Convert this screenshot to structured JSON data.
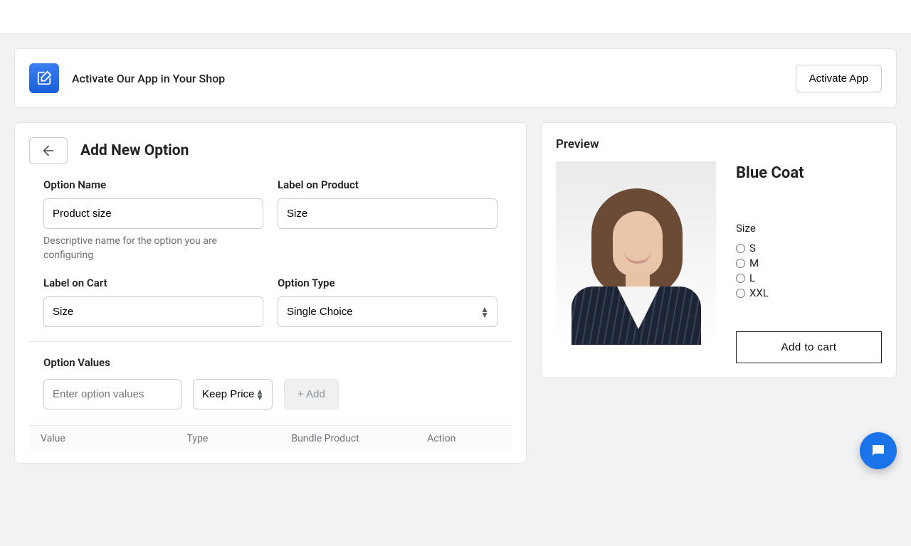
{
  "banner": {
    "title": "Activate Our App in Your Shop",
    "button": "Activate App"
  },
  "form": {
    "page_title": "Add New Option",
    "option_name": {
      "label": "Option Name",
      "value": "Product size",
      "helper": "Descriptive name for the option you are configuring"
    },
    "label_product": {
      "label": "Label on Product",
      "value": "Size"
    },
    "label_cart": {
      "label": "Label on Cart",
      "value": "Size"
    },
    "option_type": {
      "label": "Option Type",
      "selected": "Single Choice"
    },
    "values": {
      "heading": "Option Values",
      "input_placeholder": "Enter option values",
      "price_select": "Keep Price",
      "add_btn": "+ Add",
      "columns": {
        "value": "Value",
        "type": "Type",
        "bundle": "Bundle Product",
        "action": "Action"
      }
    }
  },
  "preview": {
    "heading": "Preview",
    "product_name": "Blue Coat",
    "option_label": "Size",
    "options": [
      "S",
      "M",
      "L",
      "XXL"
    ],
    "add_to_cart": "Add to cart"
  }
}
